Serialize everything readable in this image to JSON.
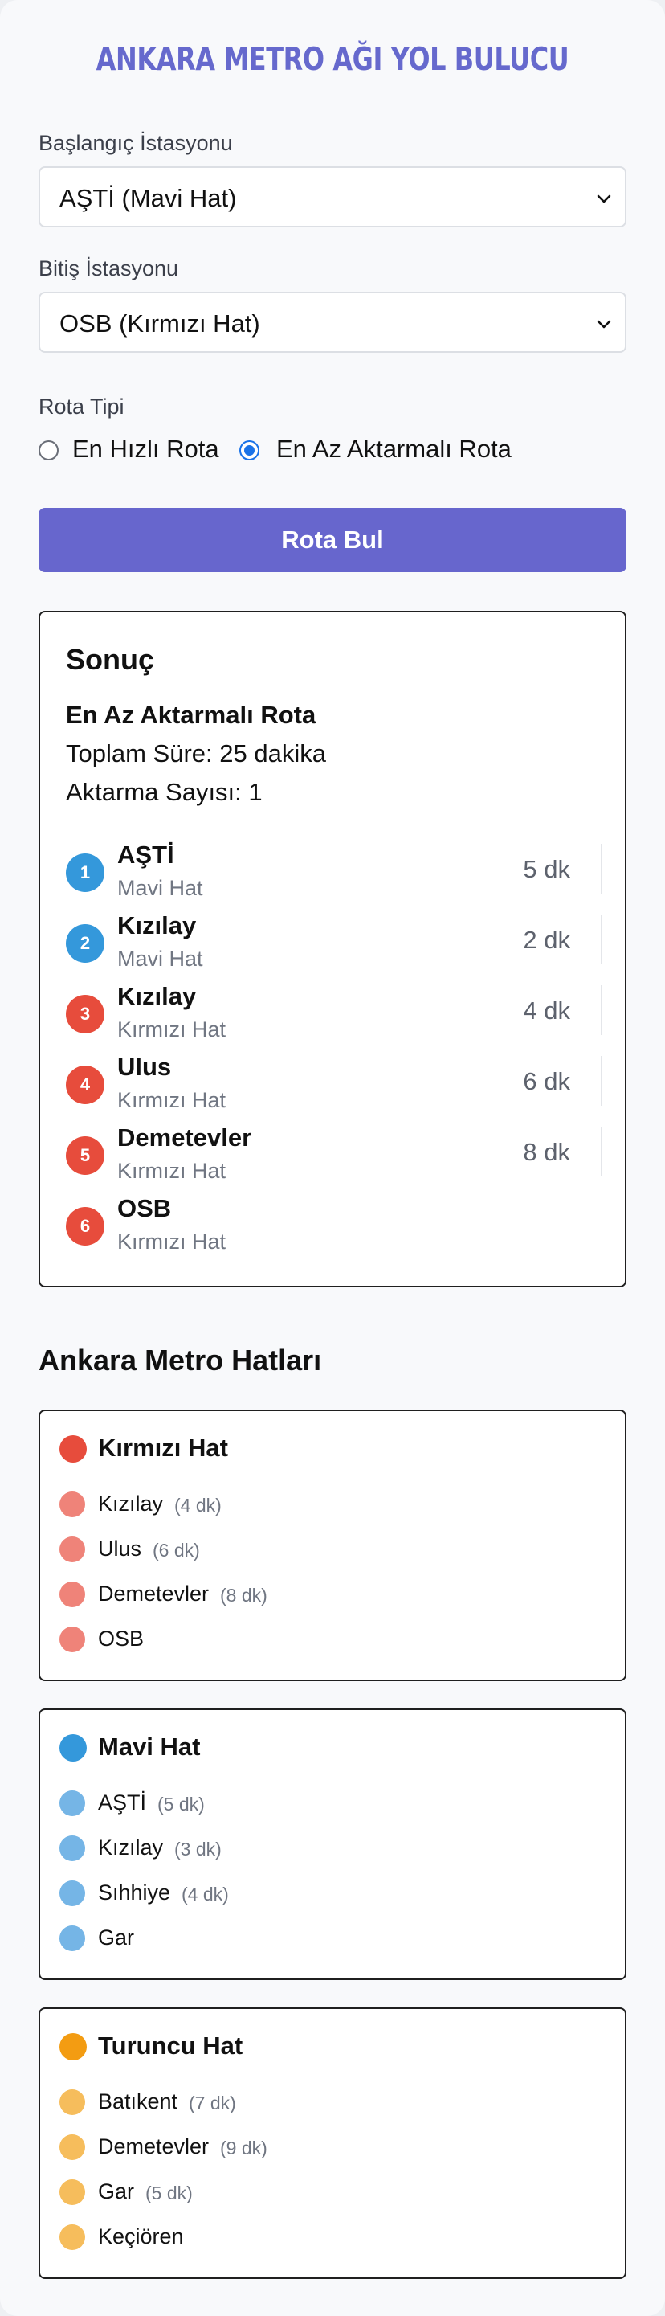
{
  "title": "ANKARA METRO AĞI YOL BULUCU",
  "colors": {
    "accent": "#6766cd",
    "red": "#e74c3c",
    "blue": "#3498db",
    "orange": "#f39c12"
  },
  "form": {
    "start_label": "Başlangıç İstasyonu",
    "start_value": "AŞTİ (Mavi Hat)",
    "end_label": "Bitiş İstasyonu",
    "end_value": "OSB (Kırmızı Hat)",
    "route_type_label": "Rota Tipi",
    "option_fastest": "En Hızlı Rota",
    "option_least_transfer": "En Az Aktarmalı Rota",
    "selected_option": "En Az Aktarmalı Rota",
    "submit_label": "Rota Bul"
  },
  "result": {
    "heading": "Sonuç",
    "route_type": "En Az Aktarmalı Rota",
    "total_time": "Toplam Süre: 25 dakika",
    "transfers": "Aktarma Sayısı: 1",
    "steps": [
      {
        "num": "1",
        "name": "AŞTİ",
        "line": "Mavi Hat",
        "time": "5 dk",
        "color": "#3498db"
      },
      {
        "num": "2",
        "name": "Kızılay",
        "line": "Mavi Hat",
        "time": "2 dk",
        "color": "#3498db"
      },
      {
        "num": "3",
        "name": "Kızılay",
        "line": "Kırmızı Hat",
        "time": "4 dk",
        "color": "#e74c3c"
      },
      {
        "num": "4",
        "name": "Ulus",
        "line": "Kırmızı Hat",
        "time": "6 dk",
        "color": "#e74c3c"
      },
      {
        "num": "5",
        "name": "Demetevler",
        "line": "Kırmızı Hat",
        "time": "8 dk",
        "color": "#e74c3c"
      },
      {
        "num": "6",
        "name": "OSB",
        "line": "Kırmızı Hat",
        "time": "",
        "color": "#e74c3c"
      }
    ]
  },
  "lines_heading": "Ankara Metro Hatları",
  "lines": [
    {
      "name": "Kırmızı Hat",
      "color": "#e74c3c",
      "light": "#ef8379",
      "stations": [
        {
          "name": "Kızılay",
          "time": "(4 dk)"
        },
        {
          "name": "Ulus",
          "time": "(6 dk)"
        },
        {
          "name": "Demetevler",
          "time": "(8 dk)"
        },
        {
          "name": "OSB",
          "time": ""
        }
      ]
    },
    {
      "name": "Mavi Hat",
      "color": "#3498db",
      "light": "#75b5e6",
      "stations": [
        {
          "name": "AŞTİ",
          "time": "(5 dk)"
        },
        {
          "name": "Kızılay",
          "time": "(3 dk)"
        },
        {
          "name": "Sıhhiye",
          "time": "(4 dk)"
        },
        {
          "name": "Gar",
          "time": ""
        }
      ]
    },
    {
      "name": "Turuncu Hat",
      "color": "#f39c12",
      "light": "#f6bd5c",
      "stations": [
        {
          "name": "Batıkent",
          "time": "(7 dk)"
        },
        {
          "name": "Demetevler",
          "time": "(9 dk)"
        },
        {
          "name": "Gar",
          "time": "(5 dk)"
        },
        {
          "name": "Keçiören",
          "time": ""
        }
      ]
    }
  ]
}
